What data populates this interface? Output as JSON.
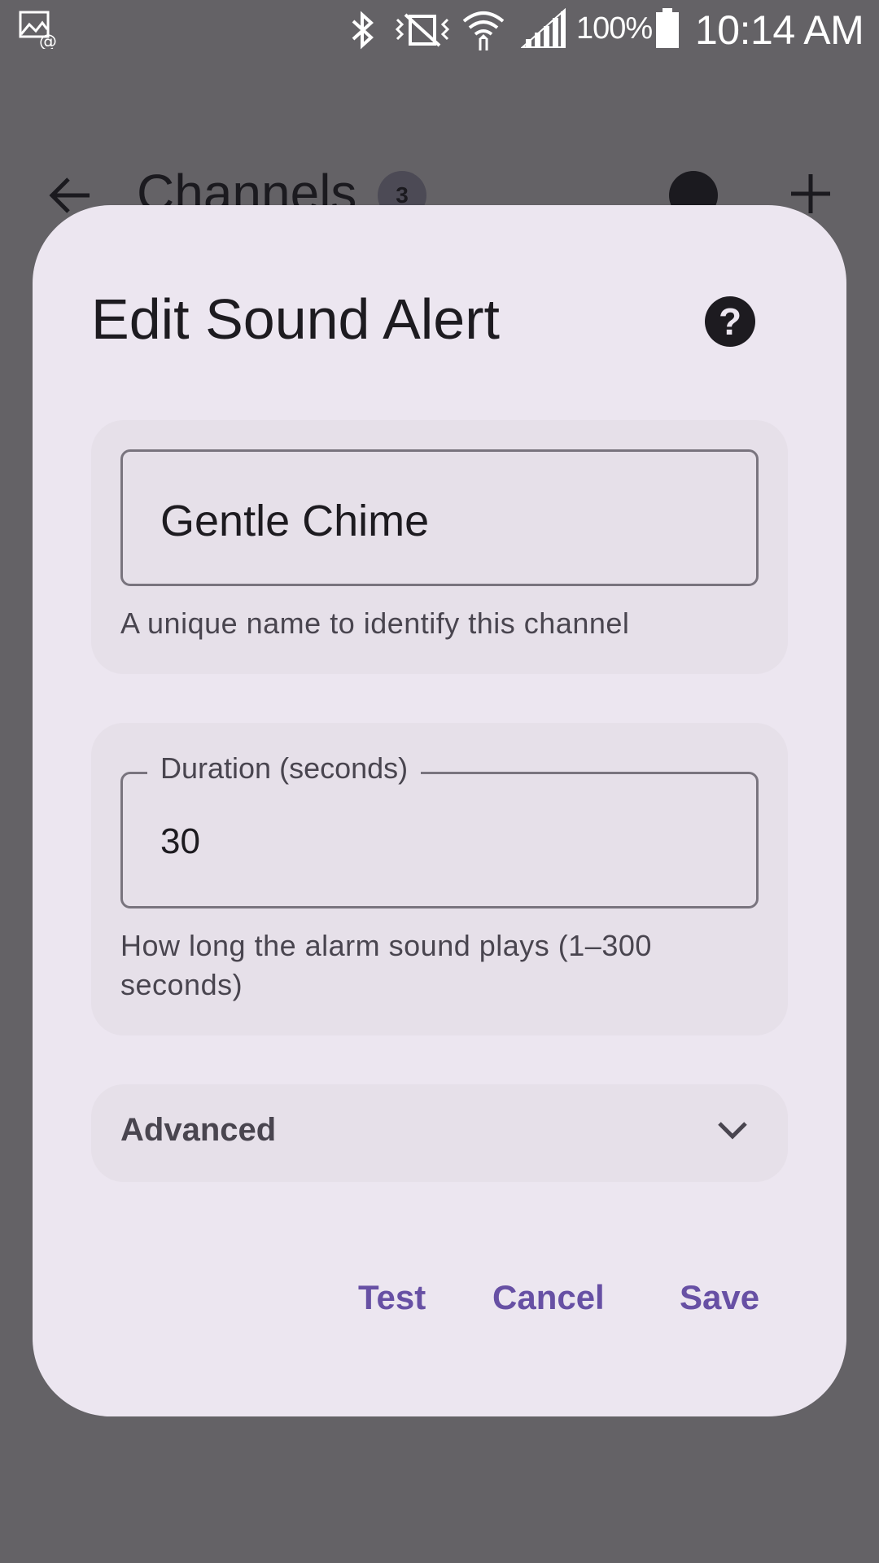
{
  "status_bar": {
    "battery_percent": "100%",
    "time": "10:14 AM",
    "icons": [
      "screenshot-email-icon",
      "bluetooth-icon",
      "vibrate-off-icon",
      "wifi-icon",
      "cellular-signal-icon",
      "battery-icon"
    ]
  },
  "background_screen": {
    "title": "Channels",
    "badge_count": "3",
    "icons": [
      "back-arrow-icon",
      "help-icon",
      "add-icon"
    ]
  },
  "dialog": {
    "title": "Edit Sound Alert",
    "name_field": {
      "value": "Gentle Chime",
      "supporting_text": "A unique name to identify this channel"
    },
    "duration_field": {
      "label": "Duration (seconds)",
      "value": "30",
      "supporting_text": "How long the alarm sound plays (1–300 seconds)"
    },
    "advanced": {
      "label": "Advanced"
    },
    "actions": {
      "test_label": "Test",
      "cancel_label": "Cancel",
      "save_label": "Save"
    }
  },
  "colors": {
    "scrim": "#646266",
    "dialog_surface": "#ece6f0",
    "card_surface": "#e6e0e9",
    "primary": "#6750a4",
    "on_surface": "#1d1b20",
    "on_surface_variant": "#49454f",
    "outline": "#79747e"
  }
}
